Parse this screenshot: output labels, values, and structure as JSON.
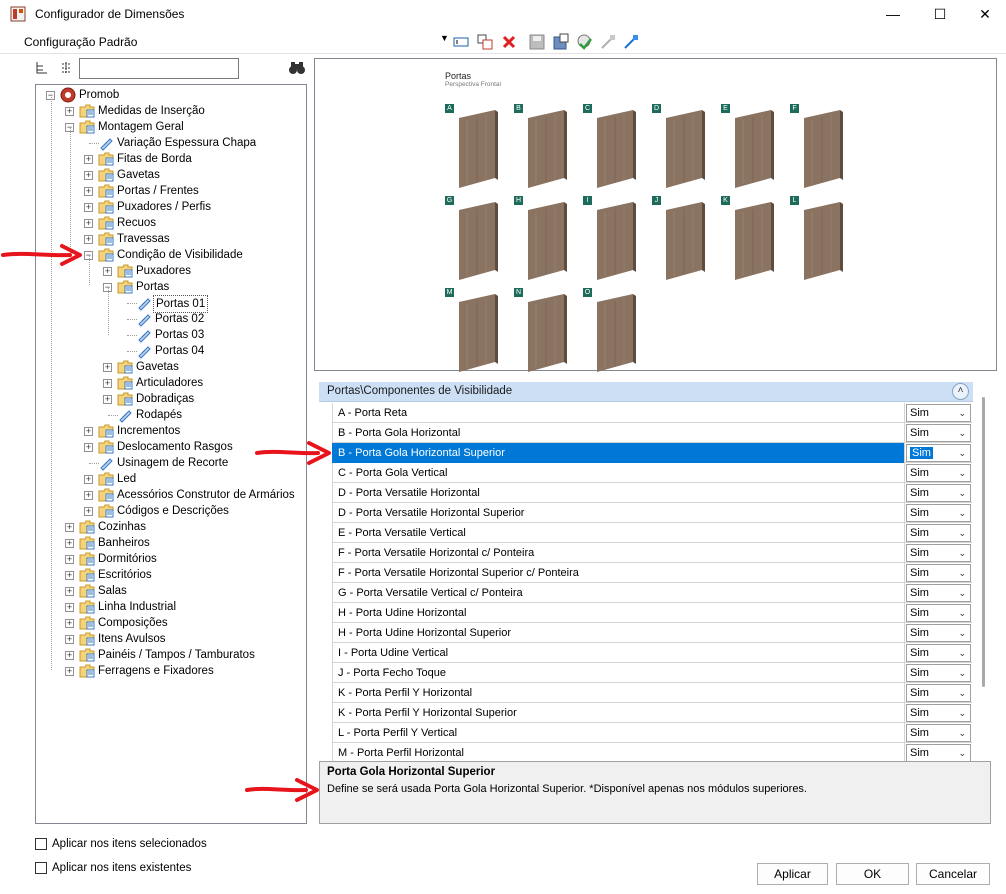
{
  "window": {
    "title": "Configurador de Dimensões"
  },
  "toolbar": {
    "config_label": "Configuração Padrão"
  },
  "tree": {
    "search_placeholder": "",
    "nodes": [
      {
        "label": "Promob"
      },
      {
        "label": "Medidas de Inserção"
      },
      {
        "label": "Montagem Geral"
      },
      {
        "label": "Variação Espessura Chapa"
      },
      {
        "label": "Fitas de Borda"
      },
      {
        "label": "Gavetas"
      },
      {
        "label": "Portas / Frentes"
      },
      {
        "label": "Puxadores / Perfis"
      },
      {
        "label": "Recuos"
      },
      {
        "label": "Travessas"
      },
      {
        "label": "Condição de Visibilidade"
      },
      {
        "label": "Puxadores"
      },
      {
        "label": "Portas"
      },
      {
        "label": "Portas 01"
      },
      {
        "label": "Portas 02"
      },
      {
        "label": "Portas 03"
      },
      {
        "label": "Portas 04"
      },
      {
        "label": "Gavetas"
      },
      {
        "label": "Articuladores"
      },
      {
        "label": "Dobradiças"
      },
      {
        "label": "Rodapés"
      },
      {
        "label": "Incrementos"
      },
      {
        "label": "Deslocamento Rasgos"
      },
      {
        "label": "Usinagem de Recorte"
      },
      {
        "label": "Led"
      },
      {
        "label": "Acessórios Construtor de Armários"
      },
      {
        "label": "Códigos e Descrições"
      },
      {
        "label": "Cozinhas"
      },
      {
        "label": "Banheiros"
      },
      {
        "label": "Dormitórios"
      },
      {
        "label": "Escritórios"
      },
      {
        "label": "Salas"
      },
      {
        "label": "Linha Industrial"
      },
      {
        "label": "Composições"
      },
      {
        "label": "Itens Avulsos"
      },
      {
        "label": "Painéis / Tampos / Tamburatos"
      },
      {
        "label": "Ferragens e Fixadores"
      }
    ]
  },
  "preview": {
    "title": "Portas",
    "subtitle": "Perspectiva Frontal",
    "tags": [
      "A",
      "B",
      "C",
      "D",
      "E",
      "F",
      "G",
      "H",
      "I",
      "J",
      "K",
      "L",
      "M",
      "N",
      "O"
    ],
    "door_color": "#8a7361"
  },
  "panel": {
    "title": "Portas\\Componentes de Visibilidade",
    "rows": [
      {
        "name": "A - Porta Reta",
        "value": "Sim"
      },
      {
        "name": "B - Porta Gola Horizontal",
        "value": "Sim"
      },
      {
        "name": "B - Porta Gola Horizontal Superior",
        "value": "Sim"
      },
      {
        "name": "C - Porta Gola Vertical",
        "value": "Sim"
      },
      {
        "name": "D - Porta Versatile Horizontal",
        "value": "Sim"
      },
      {
        "name": "D - Porta Versatile Horizontal Superior",
        "value": "Sim"
      },
      {
        "name": "E - Porta Versatile Vertical",
        "value": "Sim"
      },
      {
        "name": "F - Porta Versatile Horizontal c/ Ponteira",
        "value": "Sim"
      },
      {
        "name": "F - Porta Versatile Horizontal Superior c/ Ponteira",
        "value": "Sim"
      },
      {
        "name": "G - Porta Versatile Vertical c/ Ponteira",
        "value": "Sim"
      },
      {
        "name": "H - Porta Udine Horizontal",
        "value": "Sim"
      },
      {
        "name": "H - Porta Udine Horizontal Superior",
        "value": "Sim"
      },
      {
        "name": "I - Porta Udine Vertical",
        "value": "Sim"
      },
      {
        "name": "J - Porta Fecho Toque",
        "value": "Sim"
      },
      {
        "name": "K - Porta Perfil Y Horizontal",
        "value": "Sim"
      },
      {
        "name": "K - Porta Perfil Y Horizontal Superior",
        "value": "Sim"
      },
      {
        "name": "L - Porta Perfil Y Vertical",
        "value": "Sim"
      },
      {
        "name": "M - Porta Perfil Horizontal",
        "value": "Sim"
      }
    ]
  },
  "description": {
    "title": "Porta Gola Horizontal Superior",
    "text": "Define se será usada Porta Gola Horizontal Superior. *Disponível apenas nos módulos superiores."
  },
  "options": {
    "apply_selected": "Aplicar nos itens selecionados",
    "apply_existing": "Aplicar nos itens existentes"
  },
  "buttons": {
    "apply": "Aplicar",
    "ok": "OK",
    "cancel": "Cancelar"
  },
  "colors": {
    "selection": "#0078d7",
    "panel_header": "#ccdff5",
    "annotation_arrow": "#e8141b",
    "folder": "#f5d37a"
  }
}
